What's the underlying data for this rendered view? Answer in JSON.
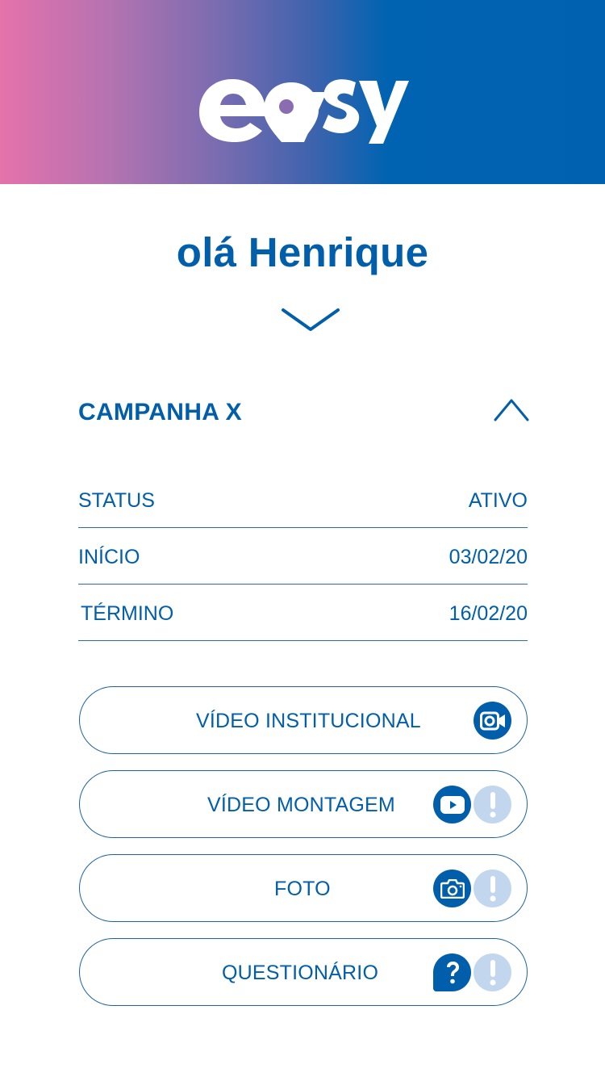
{
  "brand": {
    "name": "easy",
    "colors": {
      "primary": "#005eaa",
      "pink": "#e572ab",
      "light": "#c2d7ee"
    }
  },
  "greeting": "olá Henrique",
  "campaign": {
    "title": "CAMPANHA X",
    "rows": [
      {
        "label": "STATUS",
        "value": "ATIVO"
      },
      {
        "label": "INÍCIO",
        "value": "03/02/20"
      },
      {
        "label": "TÉRMINO",
        "value": "16/02/20"
      }
    ]
  },
  "actions": [
    {
      "label": "VÍDEO INSTITUCIONAL",
      "icons": [
        "video-camera-icon"
      ]
    },
    {
      "label": "VÍDEO MONTAGEM",
      "icons": [
        "play-icon",
        "alert-icon"
      ]
    },
    {
      "label": "FOTO",
      "icons": [
        "camera-icon",
        "alert-icon"
      ]
    },
    {
      "label": "QUESTIONÁRIO",
      "icons": [
        "question-icon",
        "alert-icon"
      ]
    }
  ]
}
